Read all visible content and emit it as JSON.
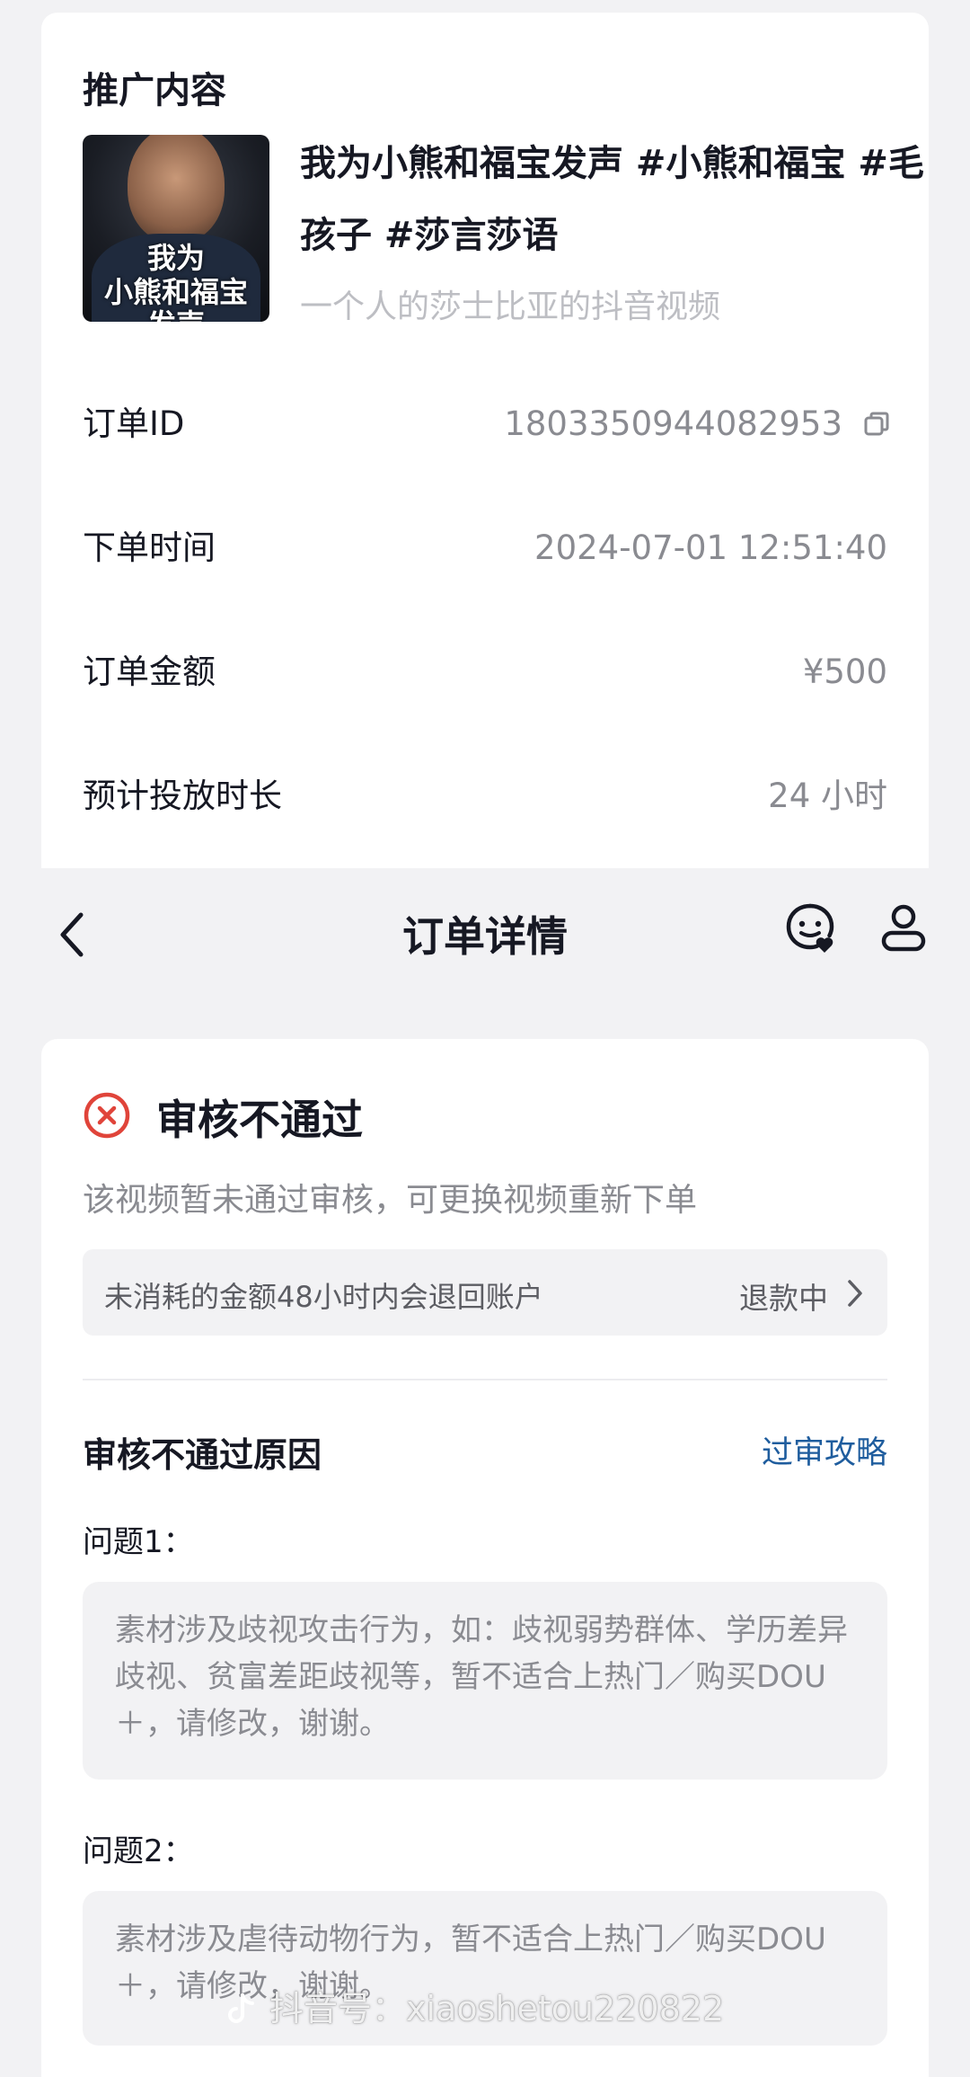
{
  "promo": {
    "section_title": "推广内容",
    "thumbnail": {
      "caption_line1": "我为",
      "caption_line2": "小熊和福宝",
      "caption_line3": "发声"
    },
    "video_title": "我为小熊和福宝发声 #小熊和福宝 #毛孩子 #莎言莎语",
    "video_author": "一个人的莎士比亚的抖音视频"
  },
  "order_info": [
    {
      "key": "订单ID",
      "value": "1803350944082953"
    },
    {
      "key": "下单时间",
      "value": "2024-07-01 12:51:40"
    },
    {
      "key": "订单金额",
      "value": "¥500"
    },
    {
      "key": "预计投放时长",
      "value": "24 小时"
    }
  ],
  "nav": {
    "title": "订单详情",
    "icons": [
      "back-arrow-icon",
      "customer-service-icon",
      "user-icon"
    ]
  },
  "review": {
    "status_title": "审核不通过",
    "status_desc": "该视频暂未通过审核，可更换视频重新下单",
    "refund_note": "未消耗的金额48小时内会退回账户",
    "refund_status": "退款中",
    "reason_title": "审核不通过原因",
    "guide_link": "过审攻略",
    "issues": [
      {
        "label": "问题1：",
        "text": "素材涉及歧视攻击行为，如：歧视弱势群体、学历差异歧视、贫富差距歧视等，暂不适合上热门／购买DOU＋，请修改，谢谢。"
      },
      {
        "label": "问题2：",
        "text": "素材涉及虐待动物行为，暂不适合上热门／购买DOU＋，请修改，谢谢。"
      }
    ]
  },
  "watermark": "抖音号：xiaoshetou220822",
  "colors": {
    "background": "#f2f2f4",
    "card": "#ffffff",
    "primary_text": "#161823",
    "secondary_text": "#8a8b91",
    "link": "#1f5d9e",
    "error": "#e0443a"
  }
}
